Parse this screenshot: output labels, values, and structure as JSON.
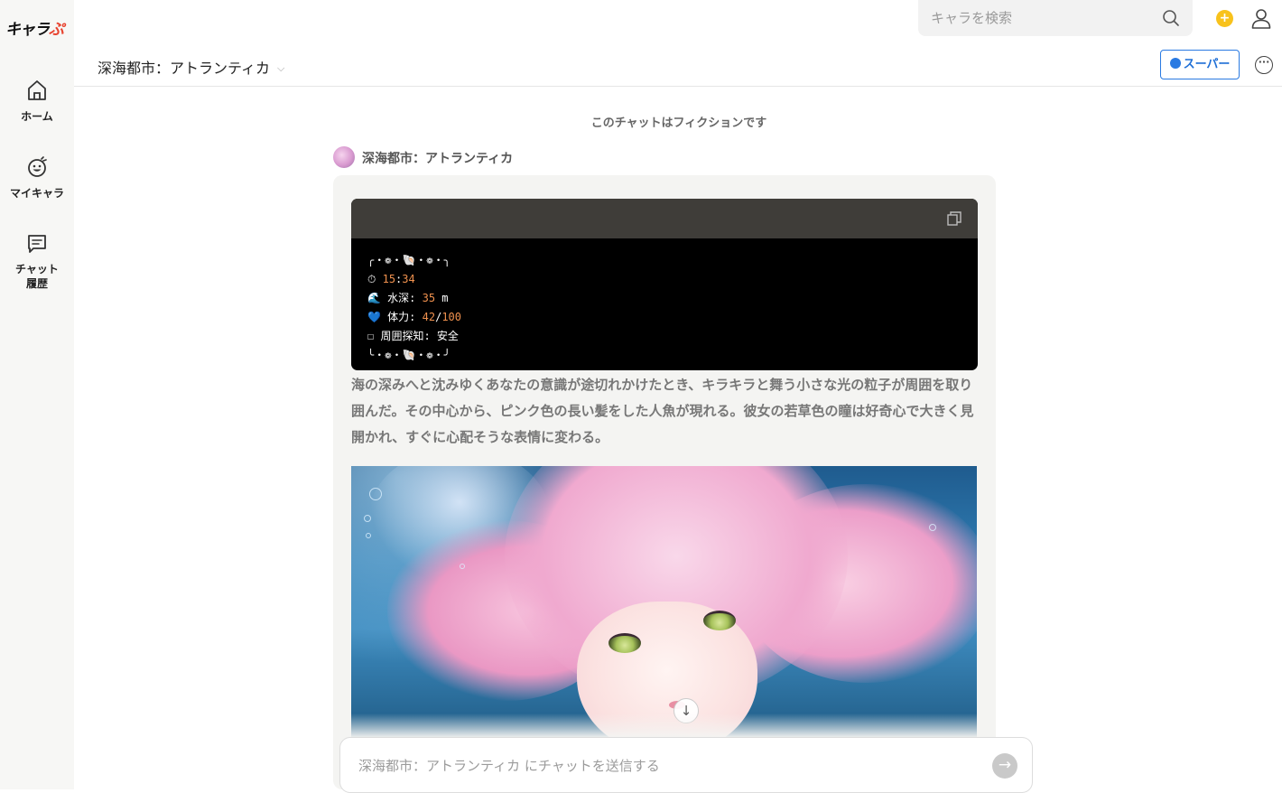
{
  "app": {
    "logo_main": "キャラ",
    "logo_accent": "ぷ"
  },
  "sidebar": {
    "items": [
      {
        "label": "ホーム",
        "icon": "home-icon"
      },
      {
        "label": "マイキャラ",
        "icon": "smile-icon"
      },
      {
        "label_line1": "チャット",
        "label_line2": "履歴",
        "icon": "chat-icon"
      }
    ]
  },
  "topbar": {
    "search_placeholder": "キャラを検索",
    "coin_symbol": "+"
  },
  "header": {
    "title": "深海都市：アトランティカ",
    "super_label": "スーパー"
  },
  "chat": {
    "fiction_note": "このチャットはフィクションです",
    "author_name": "深海都市：アトランティカ",
    "status_block": {
      "frame_top": "╭・❁・🐚・❁・╮",
      "time_label": "⏱ ",
      "time_h": "15",
      "time_m": "34",
      "depth_label": "🌊 水深: ",
      "depth_value": "35",
      "depth_unit": " m",
      "hp_label": "💙 体力: ",
      "hp_value": "42",
      "hp_max": "100",
      "scan_label": "☐ 周囲探知: ",
      "scan_value": "安全",
      "frame_bottom": "╰・❁・🐚・❁・╯"
    },
    "narration": "海の深みへと沈みゆくあなたの意識が途切れかけたとき、キラキラと舞う小さな光の粒子が周囲を取り囲んだ。その中心から、ピンク色の長い髪をした人魚が現れる。彼女の若草色の瞳は好奇心で大きく見開かれ、すぐに心配そうな表情に変わる。",
    "scroll_down_symbol": "↓"
  },
  "composer": {
    "placeholder": "深海都市：アトランティカ にチャットを送信する",
    "send_symbol": "→"
  },
  "colors": {
    "accent_blue": "#2a7ae2",
    "coin_yellow": "#f8c21c",
    "code_number": "#f0914e"
  }
}
